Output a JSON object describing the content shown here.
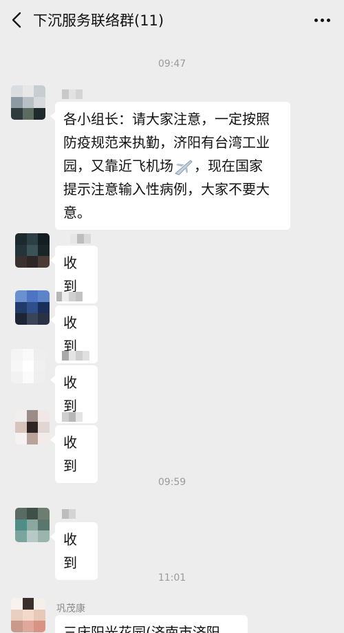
{
  "header": {
    "back_icon": "chevron-left-icon",
    "title": "下沉服务联络群(11)",
    "more_icon": "more-dots-icon"
  },
  "timestamps": [
    "09:47",
    "09:59",
    "11:01"
  ],
  "messages": [
    {
      "sender": "",
      "text_lines": [
        "各小组长：请大家注意，一定按照",
        "防疫规范来执勤，济阳有台湾工业",
        "园，又靠近飞机场",
        "，现在国家",
        "提示注意输入性病例，大家不要大",
        "意。"
      ],
      "emoji": "airplane-emoji"
    },
    {
      "sender": "",
      "text": "收到"
    },
    {
      "sender": "",
      "text": "收到"
    },
    {
      "sender": "",
      "text": "收到"
    },
    {
      "sender": "",
      "text": "收到"
    },
    {
      "sender": "",
      "text": "收到"
    },
    {
      "sender": "巩茂康",
      "text": "三庆阳光花园(济南市济阳"
    }
  ]
}
